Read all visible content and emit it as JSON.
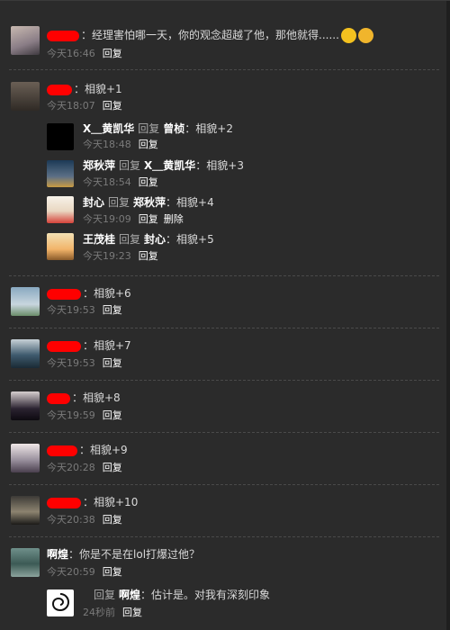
{
  "comments": [
    {
      "text": "：经理害怕哪一天，你的观念超越了他，那他就得......",
      "time": "今天16:46",
      "reply": "回复",
      "emojis": [
        "grin-emoji",
        "thinking-emoji"
      ]
    },
    {
      "text": "：相貌+1",
      "time": "今天18:07",
      "reply": "回复",
      "replies": [
        {
          "name": "X＿黄凯华",
          "reply_word": "回复",
          "target": "曾桢",
          "text": "：相貌+2",
          "time": "今天18:48",
          "reply": "回复"
        },
        {
          "name": "郑秋萍",
          "reply_word": "回复",
          "target": "X＿黄凯华",
          "text": "：相貌+3",
          "time": "今天18:54",
          "reply": "回复"
        },
        {
          "name": "封心",
          "reply_word": "回复",
          "target": "郑秋萍",
          "text": "：相貌+4",
          "time": "今天19:09",
          "reply": "回复",
          "delete": "删除"
        },
        {
          "name": "王茂桂",
          "reply_word": "回复",
          "target": "封心",
          "text": "：相貌+5",
          "time": "今天19:23",
          "reply": "回复"
        }
      ]
    },
    {
      "text": "：相貌+6",
      "time": "今天19:53",
      "reply": "回复"
    },
    {
      "text": "：相貌+7",
      "time": "今天19:53",
      "reply": "回复"
    },
    {
      "text": "：相貌+8",
      "time": "今天19:59",
      "reply": "回复"
    },
    {
      "text": "：相貌+9",
      "time": "今天20:28",
      "reply": "回复"
    },
    {
      "text": "：相貌+10",
      "time": "今天20:38",
      "reply": "回复"
    },
    {
      "name": "啊煌",
      "text": "：你是不是在lol打爆过他？",
      "time": "今天20:59",
      "reply": "回复",
      "replies": [
        {
          "reply_word": "回复",
          "target": "啊煌",
          "text": "：估计是。对我有深刻印象",
          "time": "24秒前",
          "reply": "回复"
        }
      ]
    }
  ]
}
